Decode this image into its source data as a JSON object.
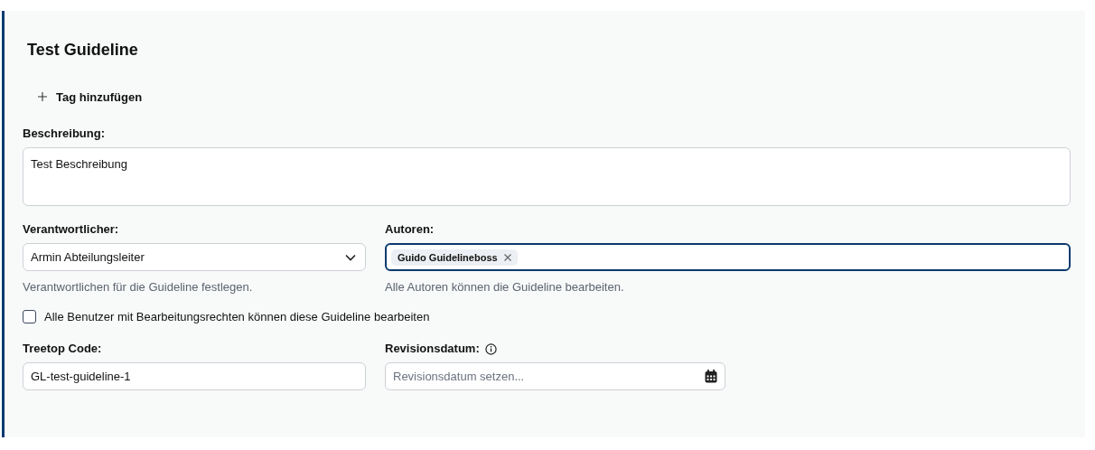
{
  "title": "Test Guideline",
  "add_tag": {
    "label": "Tag hinzufügen"
  },
  "description": {
    "label": "Beschreibung:",
    "value": "Test Beschreibung"
  },
  "responsible": {
    "label": "Verantwortlicher:",
    "value": "Armin Abteilungsleiter",
    "help": "Verantwortlichen für die Guideline festlegen."
  },
  "authors": {
    "label": "Autoren:",
    "focused": true,
    "chips": [
      "Guido Guidelineboss"
    ],
    "help": "Alle Autoren können die Guideline bearbeiten."
  },
  "edit_rights": {
    "label": "Alle Benutzer mit Bearbeitungsrechten können diese Guideline bearbeiten",
    "checked": false
  },
  "treetop_code": {
    "label": "Treetop Code:",
    "value": "GL-test-guideline-1"
  },
  "revision_date": {
    "label": "Revisionsdatum:",
    "placeholder": "Revisionsdatum setzen..."
  }
}
